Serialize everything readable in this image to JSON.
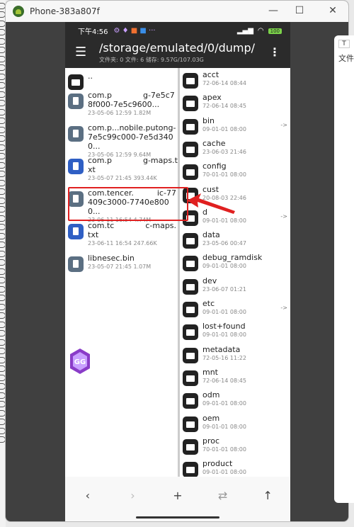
{
  "window": {
    "title": "Phone-383a807f",
    "minimize": "—",
    "maximize": "☐",
    "close": "✕"
  },
  "status": {
    "time": "下午4:56",
    "battery": "100"
  },
  "toolbar": {
    "path": "/storage/emulated/0/dump/",
    "summary": "文件夹: 0  文件: 6  储存: 9.57G/107.03G"
  },
  "left": [
    {
      "type": "folder",
      "name": "..",
      "meta": ""
    },
    {
      "type": "file",
      "name": "com.p    g-7e5c78f000-7e5c9600...",
      "meta": "23-05-06 12:59  1.82M"
    },
    {
      "type": "file",
      "name": "com.p...nobile.putong-7e5c99c000-7e5d3400...",
      "meta": "23-05-06 12:59  9.64M"
    },
    {
      "type": "txt",
      "name": "com.p    g-maps.txt",
      "meta": "23-05-07 21:45  393.44K"
    },
    {
      "type": "file",
      "name": "com.tencer.   ic-77409c3000-7740e8000...",
      "meta": "23-06-11 16:54  4.74M"
    },
    {
      "type": "txt",
      "name": "com.tc    c-maps.txt",
      "meta": "23-06-11 16:54  247.66K"
    },
    {
      "type": "file",
      "name": "libnesec.bin",
      "meta": "23-05-07 21:45  1.07M"
    }
  ],
  "right": [
    {
      "name": "acct",
      "meta": "72-06-14 08:44",
      "link": ""
    },
    {
      "name": "apex",
      "meta": "72-06-14 08:45",
      "link": ""
    },
    {
      "name": "bin",
      "meta": "09-01-01 08:00",
      "link": "->"
    },
    {
      "name": "cache",
      "meta": "23-06-03 21:46",
      "link": ""
    },
    {
      "name": "config",
      "meta": "70-01-01 08:00",
      "link": ""
    },
    {
      "name": "cust",
      "meta": "20-08-03 22:46",
      "link": ""
    },
    {
      "name": "d",
      "meta": "09-01-01 08:00",
      "link": "->"
    },
    {
      "name": "data",
      "meta": "23-05-06 00:47",
      "link": ""
    },
    {
      "name": "debug_ramdisk",
      "meta": "09-01-01 08:00",
      "link": ""
    },
    {
      "name": "dev",
      "meta": "23-06-07 01:21",
      "link": ""
    },
    {
      "name": "etc",
      "meta": "09-01-01 08:00",
      "link": "->"
    },
    {
      "name": "lost+found",
      "meta": "09-01-01 08:00",
      "link": ""
    },
    {
      "name": "metadata",
      "meta": "72-05-16 11:22",
      "link": ""
    },
    {
      "name": "mnt",
      "meta": "72-06-14 08:45",
      "link": ""
    },
    {
      "name": "odm",
      "meta": "09-01-01 08:00",
      "link": ""
    },
    {
      "name": "oem",
      "meta": "09-01-01 08:00",
      "link": ""
    },
    {
      "name": "proc",
      "meta": "70-01-01 08:00",
      "link": ""
    },
    {
      "name": "product",
      "meta": "09-01-01 08:00",
      "link": ""
    }
  ],
  "nav": {
    "back": "‹",
    "forward": "›",
    "add": "+",
    "swap": "⇄",
    "up": "↑"
  },
  "side_panel": {
    "button": "T",
    "text": "文件"
  },
  "colors": {
    "highlight": "#e02020",
    "toolbar": "#2b2b2b"
  }
}
